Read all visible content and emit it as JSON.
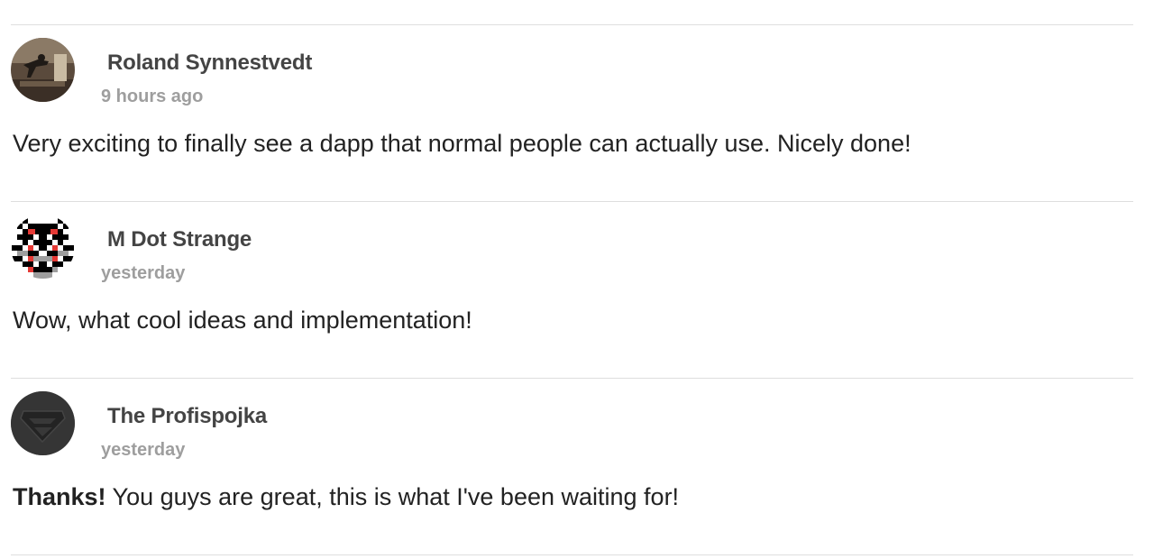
{
  "comments": [
    {
      "author": "Roland Synnestvedt",
      "time": "9 hours ago",
      "text_bold": "",
      "text": "Very exciting to finally see a dapp that normal people can actually use. Nicely done!"
    },
    {
      "author": "M Dot Strange",
      "time": "yesterday",
      "text_bold": "",
      "text": "Wow, what cool ideas and implementation!"
    },
    {
      "author": "The Profispojka",
      "time": "yesterday",
      "text_bold": "Thanks!",
      "text": " You guys are great, this is what I've been waiting for!"
    }
  ],
  "colors": {
    "author": "#444444",
    "timestamp": "#9e9e9e",
    "text": "#222222",
    "divider": "#dedede"
  },
  "icons": [
    "avatar-photo-gym",
    "avatar-pixel-mask",
    "avatar-dark-logo"
  ]
}
